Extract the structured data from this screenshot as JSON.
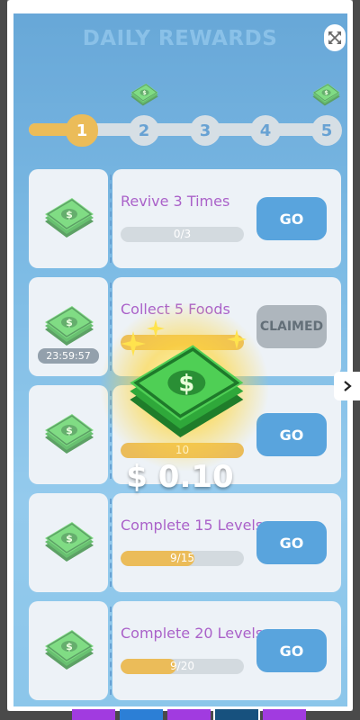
{
  "dialog": {
    "title": "DAILY REWARDS",
    "close_icon": "expand-icon"
  },
  "progress": {
    "steps": [
      "1",
      "2",
      "3",
      "4",
      "5"
    ],
    "current_step": 1,
    "reward_icons_on_steps": [
      "2",
      "5"
    ]
  },
  "tasks": [
    {
      "label": "Revive 3 Times",
      "progress_text": "0/3",
      "progress": 0.0,
      "button": "GO",
      "timer": ""
    },
    {
      "label": "Collect 5 Foods",
      "progress_text": "",
      "progress": 1.0,
      "button": "CLAIMED",
      "timer": "23:59:57"
    },
    {
      "label": "",
      "progress_text": "10",
      "progress": 1.0,
      "button": "GO",
      "timer": ""
    },
    {
      "label": "Complete 15 Levels",
      "progress_text": "9/15",
      "progress": 0.6,
      "button": "GO",
      "timer": ""
    },
    {
      "label": "Complete 20 Levels",
      "progress_text": "9/20",
      "progress": 0.45,
      "button": "GO",
      "timer": ""
    }
  ],
  "reward_popup": {
    "amount": "$ 0.10",
    "icon": "cash-stack-icon"
  },
  "colors": {
    "accent_blue": "#1a82d0",
    "progress_gold": "#e3a21a",
    "task_label": "#8a25b4",
    "claimed_gray": "#8f9aa4"
  }
}
